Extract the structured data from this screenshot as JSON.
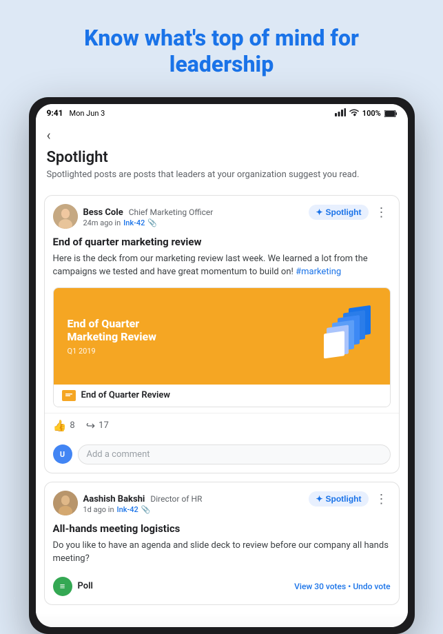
{
  "hero": {
    "title": "Know what's top of mind for leadership"
  },
  "status_bar": {
    "time": "9:41",
    "date": "Mon Jun 3",
    "signal": "●●●●",
    "wifi": "WiFi",
    "battery": "100%"
  },
  "nav": {
    "back_label": "‹"
  },
  "page": {
    "title": "Spotlight",
    "subtitle": "Spotlighted posts are posts that leaders at your organization suggest you read."
  },
  "posts": [
    {
      "author_name": "Bess Cole",
      "author_title": "Chief Marketing Officer",
      "post_time": "24m ago in",
      "channel": "Ink-42",
      "spotlight_label": "Spotlight",
      "post_title": "End of quarter marketing review",
      "post_body": "Here is the deck from our marketing review last week. We learned a lot from the campaigns we tested and have great momentum to build on! #marketing",
      "media_title": "End of Quarter\nMarketing Review",
      "media_subtitle": "Q1 2019",
      "media_link_label": "End of Quarter Review",
      "likes_count": "8",
      "shares_count": "17",
      "comment_placeholder": "Add a comment"
    },
    {
      "author_name": "Aashish Bakshi",
      "author_title": "Director of HR",
      "post_time": "1d ago in",
      "channel": "Ink-42",
      "spotlight_label": "Spotlight",
      "post_title": "All-hands meeting logistics",
      "post_body": "Do you like to have an agenda and slide deck to review before our company all hands meeting?",
      "poll_label": "Poll",
      "poll_action": "View 30 votes • Undo vote"
    }
  ]
}
